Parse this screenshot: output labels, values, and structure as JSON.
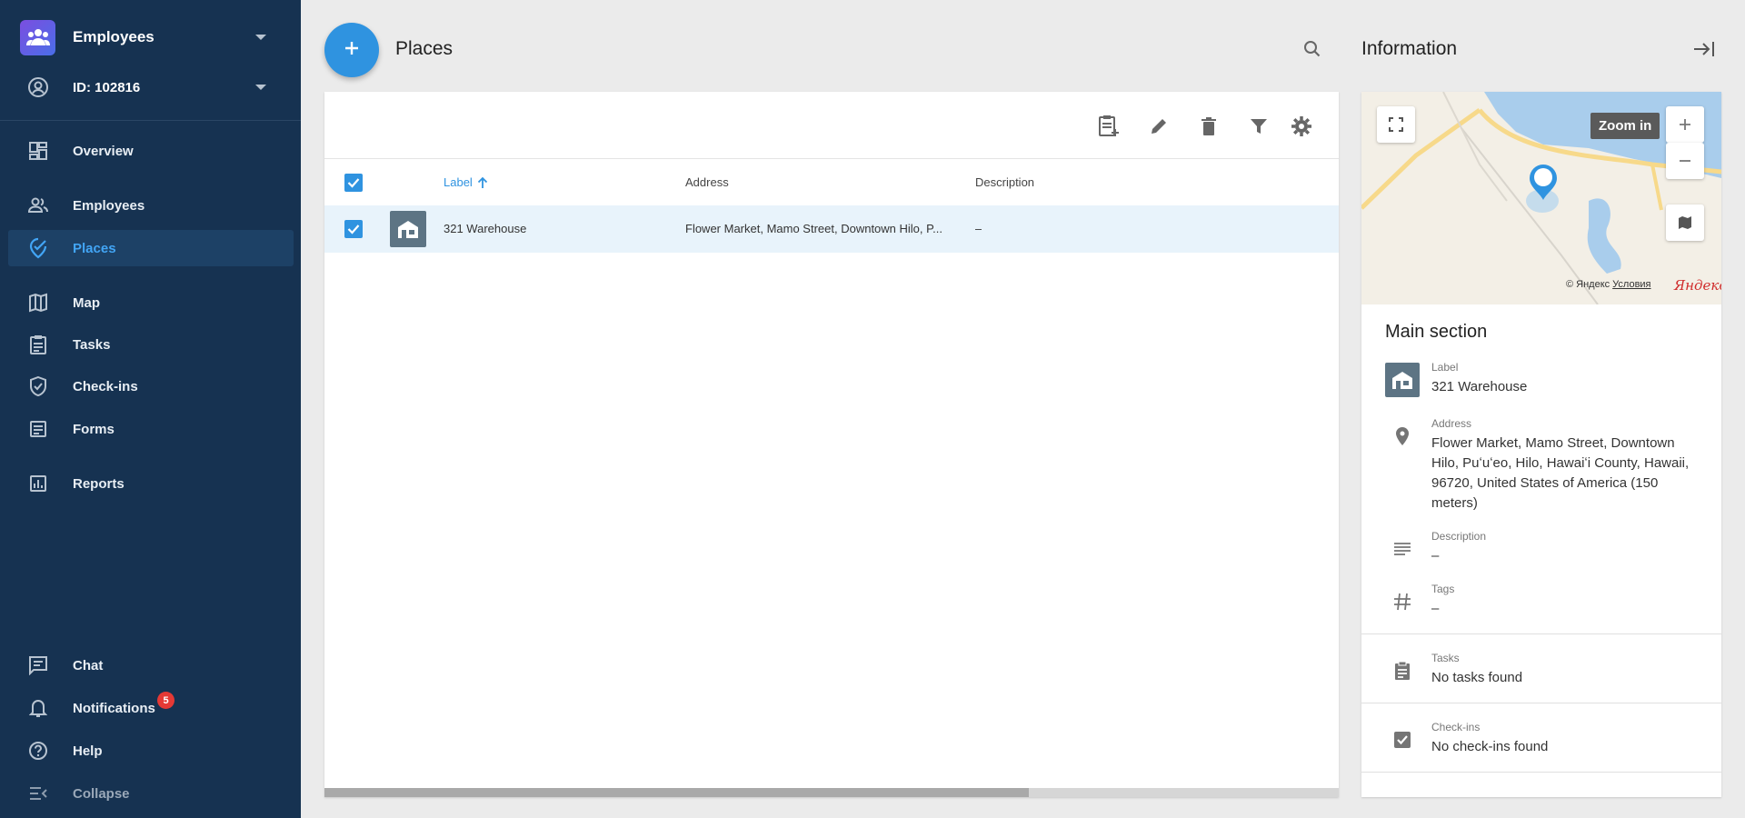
{
  "sidebar": {
    "account": {
      "name": "Employees"
    },
    "user": {
      "id_label": "ID: 102816"
    },
    "items": [
      {
        "label": "Overview"
      },
      {
        "label": "Employees"
      },
      {
        "label": "Places"
      },
      {
        "label": "Map"
      },
      {
        "label": "Tasks"
      },
      {
        "label": "Check-ins"
      },
      {
        "label": "Forms"
      },
      {
        "label": "Reports"
      }
    ],
    "bottom": [
      {
        "label": "Chat"
      },
      {
        "label": "Notifications",
        "badge": "5"
      },
      {
        "label": "Help"
      },
      {
        "label": "Collapse"
      }
    ],
    "active_item": "Places",
    "colors": {
      "background": "#163251",
      "active": "#42a5f5",
      "badge": "#e53935"
    }
  },
  "header": {
    "title": "Places",
    "add_icon": "plus-icon",
    "search_icon": "search-icon"
  },
  "toolbar": {
    "icons": [
      "clipboard-add-icon",
      "pencil-icon",
      "trash-icon",
      "filter-icon",
      "gear-icon"
    ]
  },
  "table": {
    "columns": [
      "Label",
      "Address",
      "Description"
    ],
    "sort": {
      "column": "Label",
      "direction": "ascending"
    },
    "rows": [
      {
        "selected": true,
        "label": "321 Warehouse",
        "address": "Flower Market, Mamo Street, Downtown Hilo, P...",
        "description": "–"
      }
    ]
  },
  "info": {
    "title": "Information",
    "map": {
      "zoom_tooltip": "Zoom in",
      "copyright": "© Яндекс",
      "terms": "Условия",
      "provider": "Яндекс"
    },
    "section_title": "Main section",
    "fields": {
      "label": {
        "name": "Label",
        "value": "321 Warehouse"
      },
      "address": {
        "name": "Address",
        "value": "Flower Market, Mamo Street, Downtown Hilo, Puʻuʻeo, Hilo, Hawaiʻi County, Hawaii, 96720, United States of America (150 meters)"
      },
      "description": {
        "name": "Description",
        "value": "–"
      },
      "tags": {
        "name": "Tags",
        "value": "–"
      },
      "tasks": {
        "name": "Tasks",
        "value": "No tasks found"
      },
      "checkins": {
        "name": "Check-ins",
        "value": "No check-ins found"
      }
    }
  },
  "accent": "#2f93e0"
}
